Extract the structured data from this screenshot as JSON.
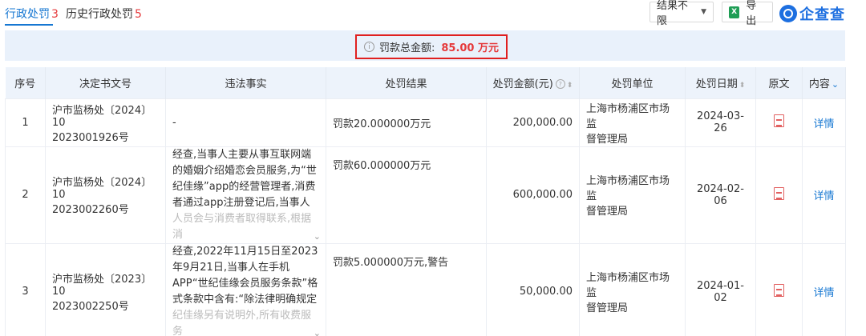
{
  "tabs": [
    {
      "label": "行政处罚",
      "count": "3"
    },
    {
      "label": "历史行政处罚",
      "count": "5"
    }
  ],
  "toolbar": {
    "filter_label": "结果不限",
    "export_label": "导出",
    "brand": "企查查"
  },
  "summary": {
    "label": "罚款总金额:",
    "value": "85.00 万元"
  },
  "table": {
    "headers": [
      "序号",
      "决定书文号",
      "违法事实",
      "处罚结果",
      "处罚金额(元)",
      "处罚单位",
      "处罚日期",
      "原文",
      "内容"
    ],
    "rows": [
      {
        "index": "1",
        "doc_no_1": "沪市监杨处〔2024〕10",
        "doc_no_2": "2023001926号",
        "fact": "-",
        "fact_fade": "",
        "result": "罚款20.000000万元",
        "amount": "200,000.00",
        "unit_1": "上海市杨浦区市场监",
        "unit_2": "督管理局",
        "date": "2024-03-26",
        "detail": "详情"
      },
      {
        "index": "2",
        "doc_no_1": "沪市监杨处〔2024〕10",
        "doc_no_2": "2023002260号",
        "fact": "经查,当事人主要从事互联网端的婚姻介绍婚恋会员服务,为“世纪佳缘”app的经营管理者,消费者通过app注册登记后,当事人销售",
        "fact_fade": "人员会与消费者取得联系,根据消",
        "result": "罚款60.000000万元",
        "amount": "600,000.00",
        "unit_1": "上海市杨浦区市场监",
        "unit_2": "督管理局",
        "date": "2024-02-06",
        "detail": "详情"
      },
      {
        "index": "3",
        "doc_no_1": "沪市监杨处〔2023〕10",
        "doc_no_2": "2023002250号",
        "fact": "经查,2022年11月15日至2023年9月21日,当事人在手机APP“世纪佳缘会员服务条款”格式条款中含有:“除法律明确规定或世",
        "fact_fade": "纪佳缘另有说明外,所有收费服务",
        "result": "罚款5.000000万元,警告",
        "amount": "50,000.00",
        "unit_1": "上海市杨浦区市场监",
        "unit_2": "督管理局",
        "date": "2024-01-02",
        "detail": "详情"
      }
    ]
  },
  "icons": {
    "info": "info-icon",
    "pdf": "pdf-icon",
    "excel": "excel-icon",
    "expand": "chevron-double-down-icon"
  },
  "colors": {
    "accent": "#1677d2",
    "danger": "#e5393b",
    "header_bg": "#edf3fb"
  }
}
